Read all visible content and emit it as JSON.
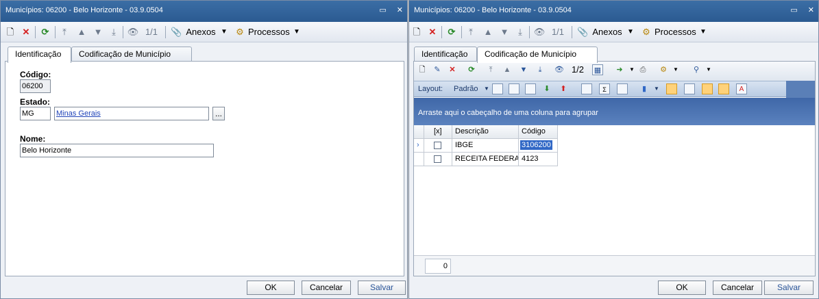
{
  "left_window": {
    "title": "Municípios: 06200 - Belo Horizonte - 03.9.0504",
    "toolbar": {
      "record_count": "1/1",
      "attachments": "Anexos",
      "processes": "Processos"
    },
    "tabs": [
      "Identificação",
      "Codificação de Município"
    ],
    "active_tab": "Identificação",
    "form": {
      "codigo_label": "Código:",
      "codigo_value": "06200",
      "estado_label": "Estado:",
      "estado_code": "MG",
      "estado_name": "Minas Gerais",
      "lookup_button": "...",
      "nome_label": "Nome:",
      "nome_value": "Belo Horizonte"
    },
    "buttons": {
      "ok": "OK",
      "cancel": "Cancelar",
      "save": "Salvar"
    }
  },
  "right_window": {
    "title": "Municípios: 06200 - Belo Horizonte - 03.9.0504",
    "toolbar": {
      "record_count": "1/1",
      "attachments": "Anexos",
      "processes": "Processos"
    },
    "tabs": [
      "Identificação",
      "Codificação de Município"
    ],
    "active_tab": "Codificação de Município",
    "grid_toolbar": {
      "record_count": "1/2",
      "layout_label": "Layout:",
      "layout_value": "Padrão"
    },
    "group_hint": "Arraste aqui o cabeçalho de uma coluna para agrupar",
    "columns": [
      "[x]",
      "Descrição",
      "Código"
    ],
    "rows": [
      {
        "descricao": "IBGE",
        "codigo": "3106200",
        "selected": true
      },
      {
        "descricao": "RECEITA FEDERAL",
        "codigo": "4123",
        "selected": false
      }
    ],
    "footer_count": "0",
    "buttons": {
      "ok": "OK",
      "cancel": "Cancelar",
      "save": "Salvar"
    }
  },
  "window_controls": {
    "restore": "▭",
    "close": "✕"
  },
  "icons": [
    "new-icon",
    "delete-icon",
    "refresh-icon",
    "first-icon",
    "prev-icon",
    "next-icon",
    "last-icon",
    "binoculars-icon",
    "paperclip-icon",
    "gear-icon"
  ],
  "colors": {
    "title_bar": "#2b5a91",
    "group_bar": "#4a72b0",
    "selection": "#3168c6",
    "delete_red": "#d42020",
    "refresh_green": "#2a8a2a"
  }
}
